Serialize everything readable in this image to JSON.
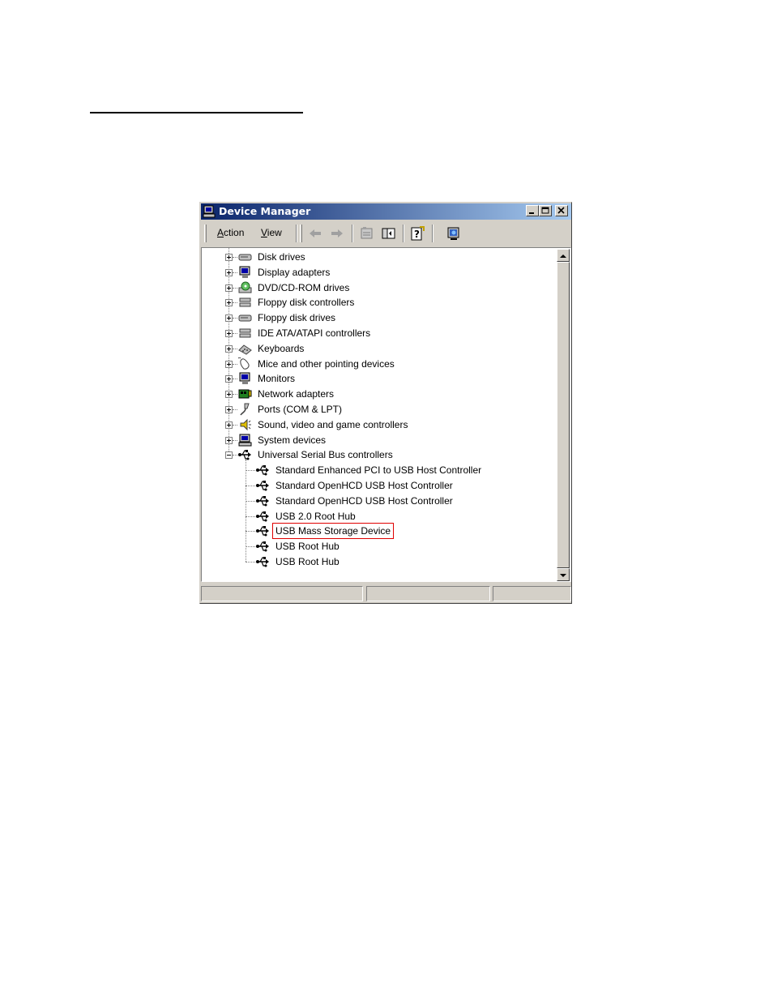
{
  "window": {
    "title": "Device Manager",
    "icon": "computer-icon",
    "controls": [
      "minimize",
      "maximize",
      "close"
    ]
  },
  "menu": {
    "action": {
      "accel": "A",
      "rest": "ction"
    },
    "view": {
      "accel": "V",
      "rest": "iew"
    }
  },
  "toolbar_icons": [
    "back-arrow-icon",
    "forward-arrow-icon",
    "properties-icon",
    "show-hide-tree-icon",
    "help-icon",
    "scan-hardware-icon"
  ],
  "tree": {
    "categories": [
      {
        "label": "Disk drives",
        "icon": "disk-drive-icon",
        "expanded": false
      },
      {
        "label": "Display adapters",
        "icon": "display-adapter-icon",
        "expanded": false
      },
      {
        "label": "DVD/CD-ROM drives",
        "icon": "cdrom-icon",
        "expanded": false
      },
      {
        "label": "Floppy disk controllers",
        "icon": "controller-icon",
        "expanded": false
      },
      {
        "label": "Floppy disk drives",
        "icon": "floppy-drive-icon",
        "expanded": false
      },
      {
        "label": "IDE ATA/ATAPI controllers",
        "icon": "controller-icon",
        "expanded": false
      },
      {
        "label": "Keyboards",
        "icon": "keyboard-icon",
        "expanded": false
      },
      {
        "label": "Mice and other pointing devices",
        "icon": "mouse-icon",
        "expanded": false
      },
      {
        "label": "Monitors",
        "icon": "monitor-icon",
        "expanded": false
      },
      {
        "label": "Network adapters",
        "icon": "network-adapter-icon",
        "expanded": false
      },
      {
        "label": "Ports (COM & LPT)",
        "icon": "port-icon",
        "expanded": false
      },
      {
        "label": "Sound, video and game controllers",
        "icon": "speaker-icon",
        "expanded": false
      },
      {
        "label": "System devices",
        "icon": "computer-icon",
        "expanded": false
      },
      {
        "label": "Universal Serial Bus controllers",
        "icon": "usb-icon",
        "expanded": true
      }
    ],
    "usb_children": [
      {
        "label": "Standard Enhanced PCI to USB Host Controller",
        "icon": "usb-icon"
      },
      {
        "label": "Standard OpenHCD USB Host Controller",
        "icon": "usb-icon"
      },
      {
        "label": "Standard OpenHCD USB Host Controller",
        "icon": "usb-icon"
      },
      {
        "label": "USB 2.0 Root Hub",
        "icon": "usb-icon"
      },
      {
        "label": "USB Mass Storage Device",
        "icon": "usb-icon",
        "highlighted": true
      },
      {
        "label": "USB Root Hub",
        "icon": "usb-icon"
      },
      {
        "label": "USB Root Hub",
        "icon": "usb-icon"
      }
    ]
  },
  "colors": {
    "titlebar_start": "#0a246a",
    "titlebar_end": "#a6caf0",
    "highlight_outline": "#e00000",
    "chrome": "#d4d0c8"
  }
}
